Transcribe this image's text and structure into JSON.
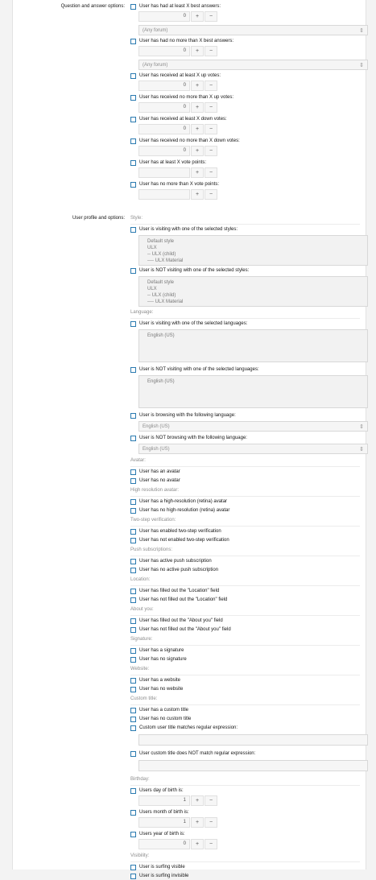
{
  "qa": {
    "heading": "Question and answer options:",
    "best_min": "User has had at least X best answers:",
    "best_max": "User has had no more than X best answers:",
    "up_min": "User has received at least X up votes:",
    "up_max": "User has received no more than X up votes:",
    "down_min": "User has received at least X down votes:",
    "down_max": "User has received no more than X down votes:",
    "points_min": "User has at least X vote points:",
    "points_max": "User has no more than X vote points:",
    "zero": "0",
    "forum_placeholder": "(Any forum)"
  },
  "profile": {
    "heading": "User profile and options:",
    "style": {
      "title": "Style:",
      "visiting": "User is visiting with one of the selected styles:",
      "not_visiting": "User is NOT visiting with one of the selected styles:",
      "options": [
        "Default style",
        "ULX",
        "-- ULX (child)",
        "---- ULX Material"
      ]
    },
    "language": {
      "title": "Language:",
      "visiting": "User is visiting with one of the selected languages:",
      "not_visiting": "User is NOT visiting with one of the selected languages:",
      "option": "English (US)",
      "browsing": "User is browsing with the following language:",
      "not_browsing": "User is NOT browsing with the following language:",
      "select_value": "English (US)"
    },
    "avatar": {
      "title": "Avatar:",
      "has": "User has an avatar",
      "no": "User has no avatar"
    },
    "hires": {
      "title": "High resolution avatar:",
      "has": "User has a high-resolution (retina) avatar",
      "no": "User has no high-resolution (retina) avatar"
    },
    "twostep": {
      "title": "Two-step verification:",
      "has": "User has enabled two-step verification",
      "no": "User has not enabled two-step verification"
    },
    "push": {
      "title": "Push subscriptions:",
      "has": "User has active push subscription",
      "no": "User has no active push subscription"
    },
    "location": {
      "title": "Location:",
      "has": "User has filled out the \"Location\" field",
      "no": "User has not filled out the \"Location\" field"
    },
    "about": {
      "title": "About you:",
      "has": "User has filled out the \"About you\" field",
      "no": "User has not filled out the \"About you\" field"
    },
    "signature": {
      "title": "Signature:",
      "has": "User has a signature",
      "no": "User has no signature"
    },
    "website": {
      "title": "Website:",
      "has": "User has a website",
      "no": "User has no website"
    },
    "custom_title": {
      "title": "Custom title:",
      "has": "User has a custom title",
      "no": "User has no custom title",
      "matches": "Custom user title matches regular expression:",
      "not_matches": "User custom title does NOT match regular expression:"
    },
    "birthday": {
      "title": "Birthday:",
      "day": "Users day of birth is:",
      "month": "Users month of birth is:",
      "year": "Users year of birth is:",
      "day_value": "1",
      "month_value": "1",
      "year_value": "0"
    },
    "visibility": {
      "title": "Visibility:",
      "visible": "User is surfing visible",
      "invisible": "User is surfing invisible"
    }
  },
  "controls": {
    "plus": "+",
    "minus": "−",
    "select_arrows": "⇕"
  }
}
